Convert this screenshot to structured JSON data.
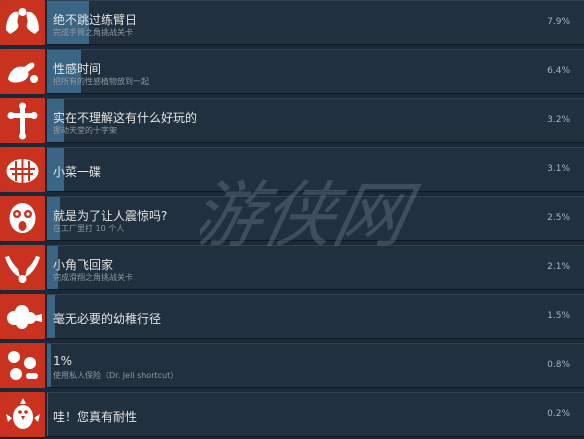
{
  "achievements": [
    {
      "title": "绝不跳过练臂日",
      "desc": "完成手臂之角挑战关卡",
      "percent": "7.9%",
      "value": 7.9,
      "icon": "muscle-arms-icon"
    },
    {
      "title": "性感时间",
      "desc": "把所有的性感植物放到一起",
      "percent": "6.4%",
      "value": 6.4,
      "icon": "flexing-hand-icon"
    },
    {
      "title": "实在不理解这有什么好玩的",
      "desc": "挪动天堂的十字架",
      "percent": "3.2%",
      "value": 3.2,
      "icon": "cross-icon"
    },
    {
      "title": "小菜一碟",
      "desc": "",
      "percent": "3.1%",
      "value": 3.1,
      "icon": "pie-icon"
    },
    {
      "title": "就是为了让人震惊吗?",
      "desc": "在工厂里打 10 个人",
      "percent": "2.5%",
      "value": 2.5,
      "icon": "shocked-face-icon"
    },
    {
      "title": "小角飞回家",
      "desc": "完成滑翔之角挑战关卡",
      "percent": "2.1%",
      "value": 2.1,
      "icon": "gliding-hands-icon"
    },
    {
      "title": "毫无必要的幼稚行径",
      "desc": "",
      "percent": "1.5%",
      "value": 1.5,
      "icon": "fart-cloud-icon"
    },
    {
      "title": "1%",
      "desc": "使用私人保险（Dr. Jell shortcut）",
      "percent": "0.8%",
      "value": 0.8,
      "icon": "pills-icon"
    },
    {
      "title": "哇！您真有耐性",
      "desc": "",
      "percent": "0.2%",
      "value": 0.2,
      "icon": "chicken-icon"
    }
  ],
  "watermark_text": "游侠网",
  "colors": {
    "icon_bg": "#c9321f",
    "bar_track": "#20303f",
    "bar_fill": "#3b6585",
    "page_bg": "#1b2838"
  }
}
